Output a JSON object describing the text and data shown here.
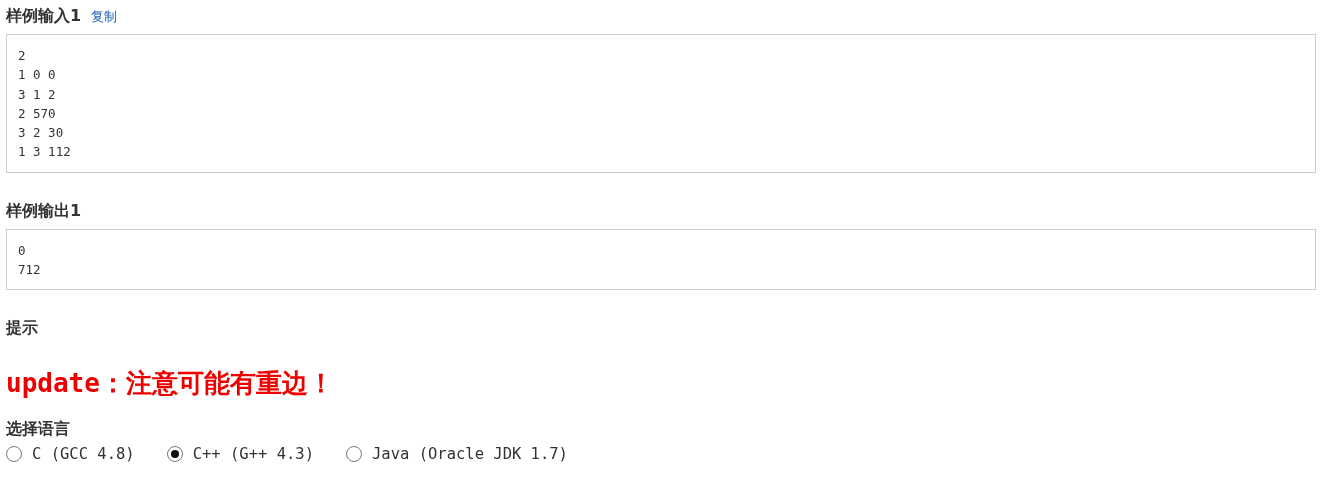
{
  "sample_input": {
    "title": "样例输入1",
    "copy_link": "复制",
    "lines": [
      "2",
      "1 0 0",
      "3 1 2",
      "2 570",
      "3 2 30",
      "1 3 112"
    ]
  },
  "sample_output": {
    "title": "样例输出1",
    "lines": [
      "0",
      "712"
    ]
  },
  "hint": {
    "title": "提示",
    "text": "update：注意可能有重边！"
  },
  "language": {
    "title": "选择语言",
    "options": [
      {
        "label": "C (GCC 4.8)",
        "selected": false
      },
      {
        "label": "C++ (G++ 4.3)",
        "selected": true
      },
      {
        "label": "Java (Oracle JDK 1.7)",
        "selected": false
      }
    ]
  }
}
